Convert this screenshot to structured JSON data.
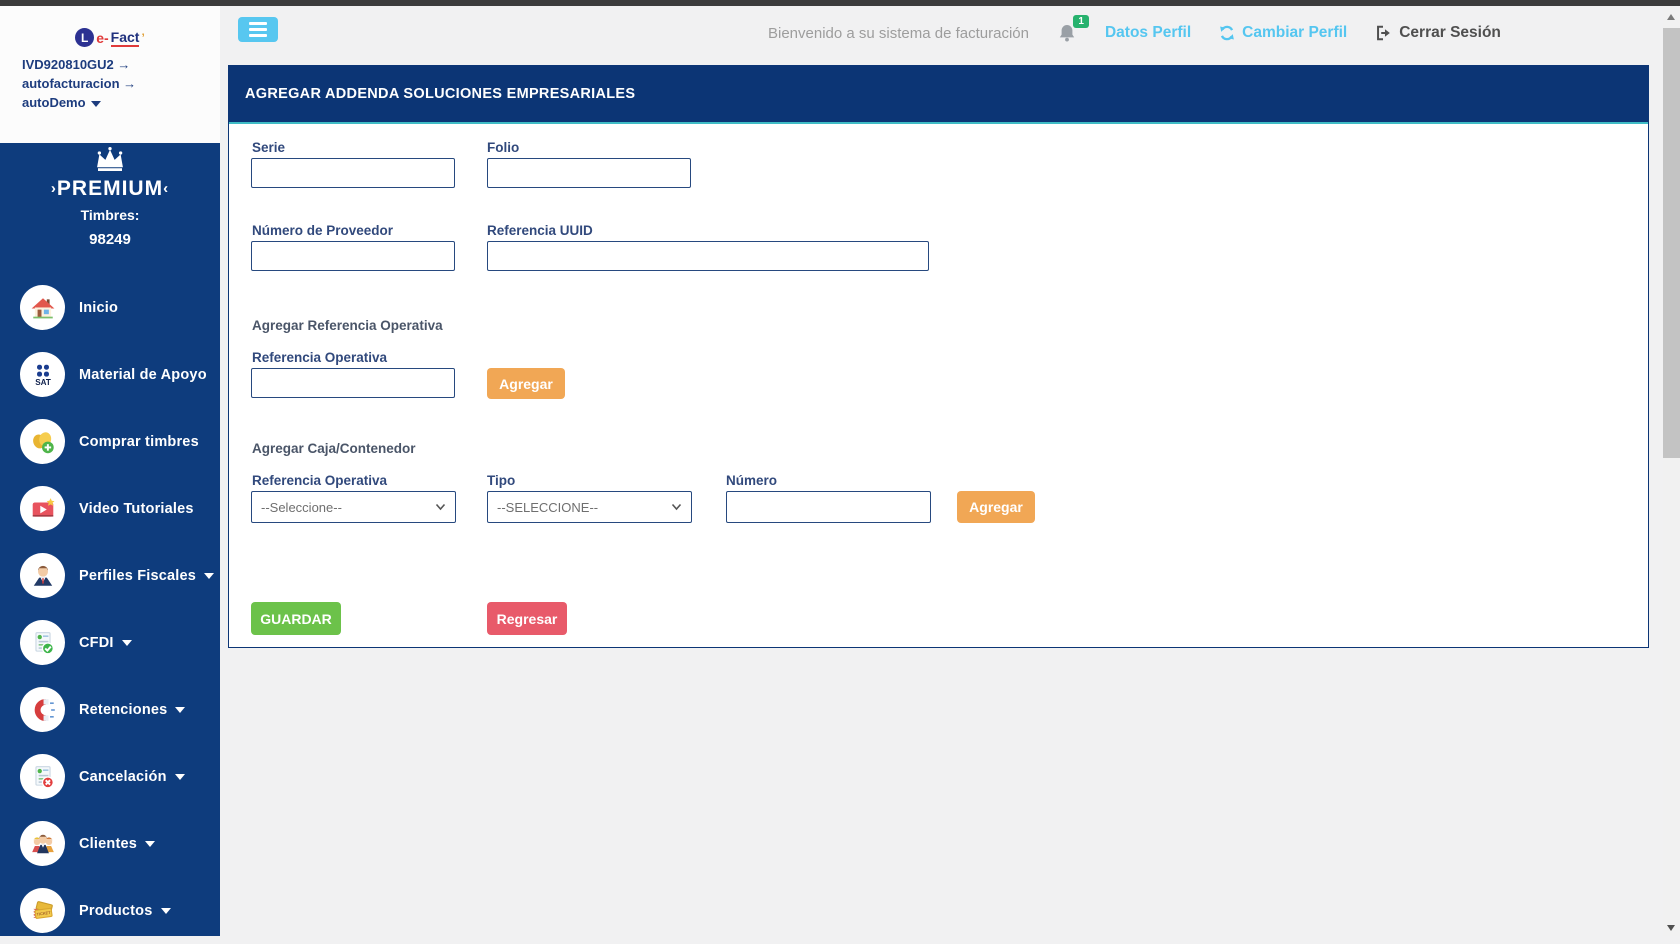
{
  "topbar": {
    "welcome": "Bienvenido a su sistema de facturación",
    "notification_count": "1",
    "datos_perfil_label": "Datos Perfil",
    "cambiar_perfil_label": "Cambiar Perfil",
    "cerrar_sesion_label": "Cerrar Sesión"
  },
  "sidebar": {
    "logo": {
      "circle_letter": "L",
      "part_red": "e-",
      "part_blue": "Fact",
      "apostrophe": "’"
    },
    "account_line1": "IVD920810GU2 →",
    "account_line2": "autofacturacion →",
    "account_line3": "autoDemo",
    "premium": {
      "label": "PREMIUM",
      "timbres_label": "Timbres:",
      "timbres_value": "98249"
    },
    "items": [
      {
        "label": "Inicio",
        "icon": "home-icon",
        "has_caret": false
      },
      {
        "label": "Material de Apoyo",
        "icon": "sat-icon",
        "has_caret": false
      },
      {
        "label": "Comprar timbres",
        "icon": "stamps-icon",
        "has_caret": false
      },
      {
        "label": "Video Tutoriales",
        "icon": "video-icon",
        "has_caret": false
      },
      {
        "label": "Perfiles Fiscales",
        "icon": "person-icon",
        "has_caret": true
      },
      {
        "label": "CFDI",
        "icon": "document-check-icon",
        "has_caret": true
      },
      {
        "label": "Retenciones",
        "icon": "magnet-icon",
        "has_caret": true
      },
      {
        "label": "Cancelación",
        "icon": "document-cancel-icon",
        "has_caret": true
      },
      {
        "label": "Clientes",
        "icon": "clients-icon",
        "has_caret": true
      },
      {
        "label": "Productos",
        "icon": "ticket-icon",
        "has_caret": true
      }
    ]
  },
  "panel": {
    "title": "AGREGAR ADDENDA SOLUCIONES EMPRESARIALES",
    "fields": {
      "serie_label": "Serie",
      "serie_value": "",
      "folio_label": "Folio",
      "folio_value": "",
      "num_proveedor_label": "Número de Proveedor",
      "num_proveedor_value": "",
      "ref_uuid_label": "Referencia UUID",
      "ref_uuid_value": ""
    },
    "ref_operativa_section": {
      "title": "Agregar Referencia Operativa",
      "field_label": "Referencia Operativa",
      "field_value": "",
      "agregar_button": "Agregar"
    },
    "caja_section": {
      "title": "Agregar Caja/Contenedor",
      "ref_operativa_label": "Referencia Operativa",
      "ref_operativa_selected": "--Seleccione--",
      "tipo_label": "Tipo",
      "tipo_selected": "--SELECCIONE--",
      "numero_label": "Número",
      "numero_value": "",
      "agregar_button": "Agregar"
    },
    "guardar_button": "GUARDAR",
    "regresar_button": "Regresar"
  },
  "colors": {
    "sidebar_navy": "#0e3c7d",
    "panel_header_navy": "#0c3575",
    "accent_light_blue": "#55c6f0",
    "teal_divider": "#3fbcc6",
    "orange_button": "#f1a755",
    "green_button": "#6cc24a",
    "red_button": "#e85a6a",
    "badge_green": "#27b26e",
    "label_navy": "#31497c",
    "welcome_gray": "#9d9d9d"
  }
}
